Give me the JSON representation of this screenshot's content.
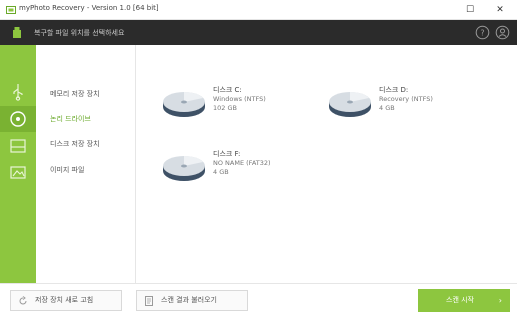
{
  "window": {
    "title": "myPhoto Recovery - Version 1.0 [64 bit]",
    "maximize_glyph": "☐",
    "close_glyph": "✕"
  },
  "header": {
    "instruction": "복구할 파일 위치를 선택하세요",
    "icons": [
      "usb-device-icon",
      "help-icon",
      "account-icon"
    ]
  },
  "sidebar": {
    "accent_color": "#8dc63f",
    "items": [
      {
        "label": "메모리 저장 장치",
        "icon": "usb-icon",
        "active": false
      },
      {
        "label": "논리 드라이브",
        "icon": "logical-drive-icon",
        "active": true
      },
      {
        "label": "디스크 저장 장치",
        "icon": "hard-disk-icon",
        "active": false
      },
      {
        "label": "이미지 파일",
        "icon": "image-file-icon",
        "active": false
      }
    ]
  },
  "drives": [
    {
      "name": "디스크 C:",
      "label": "Windows (NTFS)",
      "size": "102 GB"
    },
    {
      "name": "디스크 D:",
      "label": "Recovery (NTFS)",
      "size": "4 GB"
    },
    {
      "name": "디스크 F:",
      "label": "NO NAME (FAT32)",
      "size": "4 GB"
    }
  ],
  "footer": {
    "refresh_label": "저장 장치 새로 고침",
    "load_label": "스캔 결과 불러오기",
    "start_label": "스캔 시작",
    "start_arrow": "›"
  }
}
